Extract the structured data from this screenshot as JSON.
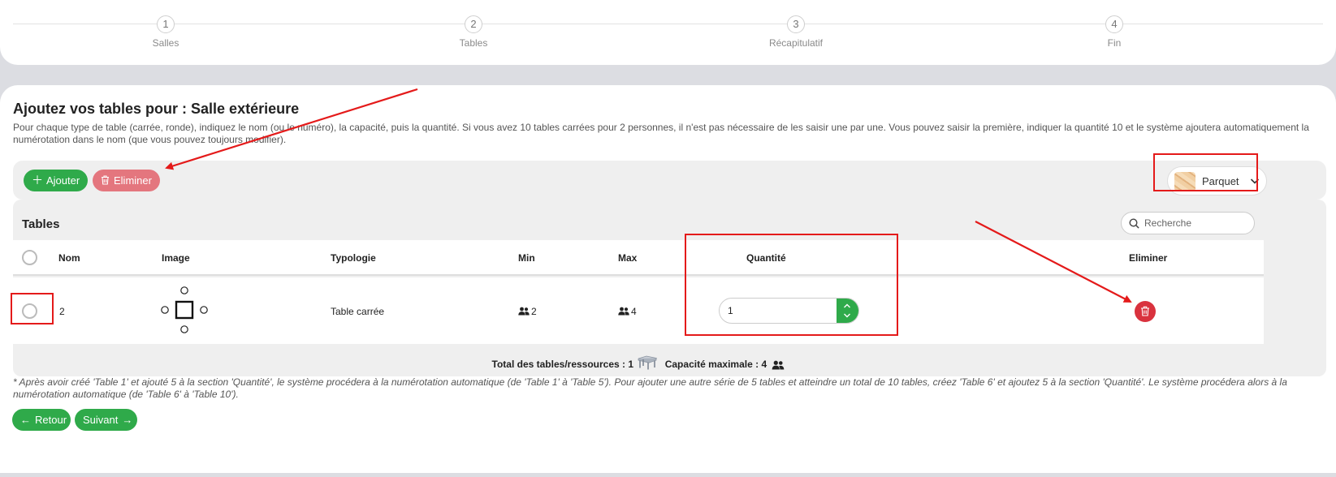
{
  "stepper": {
    "steps": [
      {
        "number": "1",
        "label": "Salles"
      },
      {
        "number": "2",
        "label": "Tables"
      },
      {
        "number": "3",
        "label": "Récapitulatif"
      },
      {
        "number": "4",
        "label": "Fin"
      }
    ]
  },
  "page": {
    "title": "Ajoutez vos tables pour : Salle extérieure",
    "intro": "Pour chaque type de table (carrée, ronde), indiquez le nom (ou le numéro), la capacité, puis la quantité. Si vous avez 10 tables carrées pour 2 personnes, il n'est pas nécessaire de les saisir une par une. Vous pouvez saisir la première, indiquer la quantité 10 et le système ajoutera automatiquement la numérotation dans le nom (que vous pouvez toujours modifier)."
  },
  "toolbar": {
    "add_label": "Ajouter",
    "delete_label": "Eliminer",
    "floor_label": "Parquet"
  },
  "tables": {
    "heading": "Tables",
    "search_placeholder": "Recherche",
    "columns": {
      "name": "Nom",
      "image": "Image",
      "type": "Typologie",
      "min": "Min",
      "max": "Max",
      "quantity": "Quantité",
      "delete": "Eliminer"
    },
    "rows": [
      {
        "name": "2",
        "image_icon": "square-table-icon",
        "type": "Table carrée",
        "min": "2",
        "max": "4",
        "quantity": "1"
      }
    ],
    "totals": {
      "tables_label": "Total des tables/ressources : 1",
      "capacity_label": "Capacité maximale : 4"
    }
  },
  "footnote": "* Après avoir créé 'Table 1' et ajouté 5 à la section 'Quantité', le système procédera à la numérotation automatique (de 'Table 1' à 'Table 5'). Pour ajouter une autre série de 5 tables et atteindre un total de 10 tables, créez 'Table 6' et ajoutez 5 à la section 'Quantité'. Le système procédera alors à la numérotation automatique (de 'Table 6' à 'Table 10').",
  "nav": {
    "back_label": "Retour",
    "next_label": "Suivant"
  },
  "colors": {
    "accent_green": "#2faa4a",
    "danger_red": "#d9323e",
    "annotation_red": "#e41a1a"
  }
}
